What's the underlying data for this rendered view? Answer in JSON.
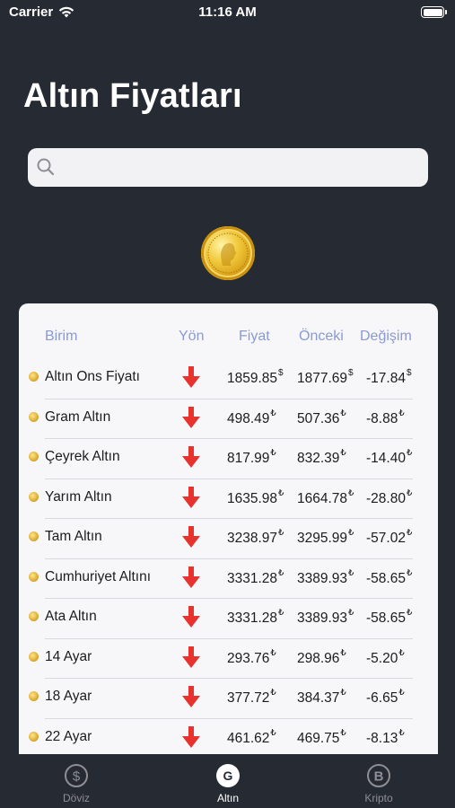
{
  "status_bar": {
    "carrier": "Carrier",
    "time": "11:16 AM"
  },
  "header": {
    "title": "Altın Fiyatları"
  },
  "search": {
    "placeholder": ""
  },
  "table": {
    "columns": [
      "Birim",
      "Yön",
      "Fiyat",
      "Önceki",
      "Değişim"
    ],
    "rows": [
      {
        "name": "Altın Ons Fiyatı",
        "direction": "down",
        "price": "1859.85",
        "previous": "1877.69",
        "change": "-17.84",
        "currency": "$"
      },
      {
        "name": "Gram Altın",
        "direction": "down",
        "price": "498.49",
        "previous": "507.36",
        "change": "-8.88",
        "currency": "₺"
      },
      {
        "name": "Çeyrek Altın",
        "direction": "down",
        "price": "817.99",
        "previous": "832.39",
        "change": "-14.40",
        "currency": "₺"
      },
      {
        "name": "Yarım Altın",
        "direction": "down",
        "price": "1635.98",
        "previous": "1664.78",
        "change": "-28.80",
        "currency": "₺"
      },
      {
        "name": "Tam Altın",
        "direction": "down",
        "price": "3238.97",
        "previous": "3295.99",
        "change": "-57.02",
        "currency": "₺"
      },
      {
        "name": "Cumhuriyet Altını",
        "direction": "down",
        "price": "3331.28",
        "previous": "3389.93",
        "change": "-58.65",
        "currency": "₺"
      },
      {
        "name": "Ata Altın",
        "direction": "down",
        "price": "3331.28",
        "previous": "3389.93",
        "change": "-58.65",
        "currency": "₺"
      },
      {
        "name": "14 Ayar",
        "direction": "down",
        "price": "293.76",
        "previous": "298.96",
        "change": "-5.20",
        "currency": "₺"
      },
      {
        "name": "18 Ayar",
        "direction": "down",
        "price": "377.72",
        "previous": "384.37",
        "change": "-6.65",
        "currency": "₺"
      },
      {
        "name": "22 Ayar",
        "direction": "down",
        "price": "461.62",
        "previous": "469.75",
        "change": "-8.13",
        "currency": "₺"
      }
    ]
  },
  "tab_bar": {
    "tabs": [
      {
        "label": "Döviz",
        "icon": "dollar-circle-icon",
        "active": false
      },
      {
        "label": "Altın",
        "icon": "g-circle-icon",
        "active": true
      },
      {
        "label": "Kripto",
        "icon": "bitcoin-circle-icon",
        "active": false
      }
    ]
  },
  "colors": {
    "background": "#262a33",
    "card": "#f7f7f9",
    "header_text": "#8a9ad2",
    "down_arrow": "#e8322d",
    "tab_inactive": "#8e8e93"
  }
}
